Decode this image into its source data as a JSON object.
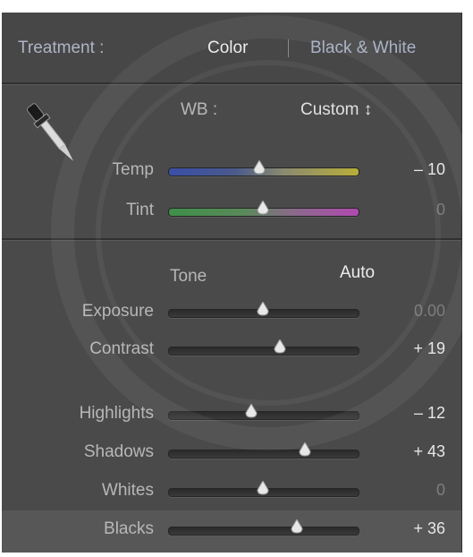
{
  "treatment": {
    "label": "Treatment :",
    "option_color": "Color",
    "option_bw": "Black & White",
    "selected": "Color"
  },
  "white_balance": {
    "label": "WB :",
    "value": "Custom ↕",
    "eyedropper_icon": "eyedropper-icon"
  },
  "sliders_wb": [
    {
      "label": "Temp",
      "value": "– 10",
      "pos": 0.48
    },
    {
      "label": "Tint",
      "value": "0",
      "pos": 0.5
    }
  ],
  "tone": {
    "label": "Tone",
    "auto_label": "Auto"
  },
  "sliders_tone": [
    {
      "label": "Exposure",
      "value": "0.00",
      "pos": 0.5
    },
    {
      "label": "Contrast",
      "value": "+ 19",
      "pos": 0.59
    }
  ],
  "sliders_presence": [
    {
      "label": "Highlights",
      "value": "– 12",
      "pos": 0.44
    },
    {
      "label": "Shadows",
      "value": "+ 43",
      "pos": 0.72
    },
    {
      "label": "Whites",
      "value": "0",
      "pos": 0.5
    },
    {
      "label": "Blacks",
      "value": "+ 36",
      "pos": 0.68
    }
  ],
  "colors": {
    "panel_bg": "#4a4a4a",
    "text_label": "#b7b7b7",
    "text_active": "#ececec",
    "temp_left": "#3a4fa8",
    "temp_right": "#b8ae3a",
    "tint_left": "#3f8f4a",
    "tint_right": "#b04ab0"
  }
}
